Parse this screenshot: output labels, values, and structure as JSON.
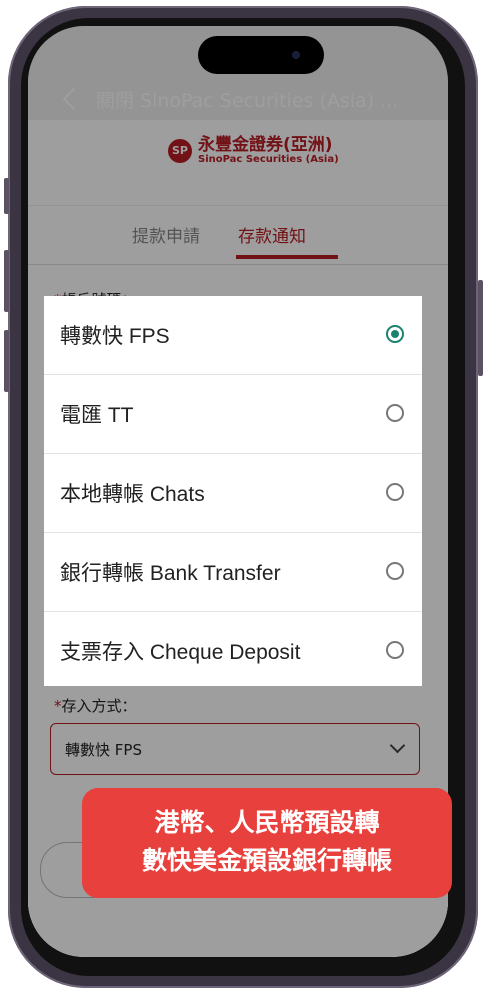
{
  "app_bar": {
    "title": "關閉 SinoPac Securities (Asia) ..."
  },
  "logo": {
    "chinese": "永豐金證券(亞洲)",
    "english": "SinoPac Securities (Asia)"
  },
  "tabs": [
    {
      "label": "提款申請",
      "active": false
    },
    {
      "label": "存款通知",
      "active": true
    }
  ],
  "form": {
    "account_label": "帳戶號碼：",
    "required_mark": "*",
    "method_label": "存入方式：",
    "method_value": "轉數快 FPS"
  },
  "dialog": {
    "options": [
      {
        "label": "轉數快 FPS",
        "selected": true
      },
      {
        "label": "電匯 TT",
        "selected": false
      },
      {
        "label": "本地轉帳 Chats",
        "selected": false
      },
      {
        "label": "銀行轉帳 Bank Transfer",
        "selected": false
      },
      {
        "label": "支票存入 Cheque Deposit",
        "selected": false
      }
    ]
  },
  "banner": {
    "line1": "港幣、人民幣預設轉",
    "line2": "數快美金預設銀行轉帳"
  },
  "colors": {
    "brand": "#b81d24",
    "radio_selected": "#18826e",
    "banner": "#e8403c"
  }
}
